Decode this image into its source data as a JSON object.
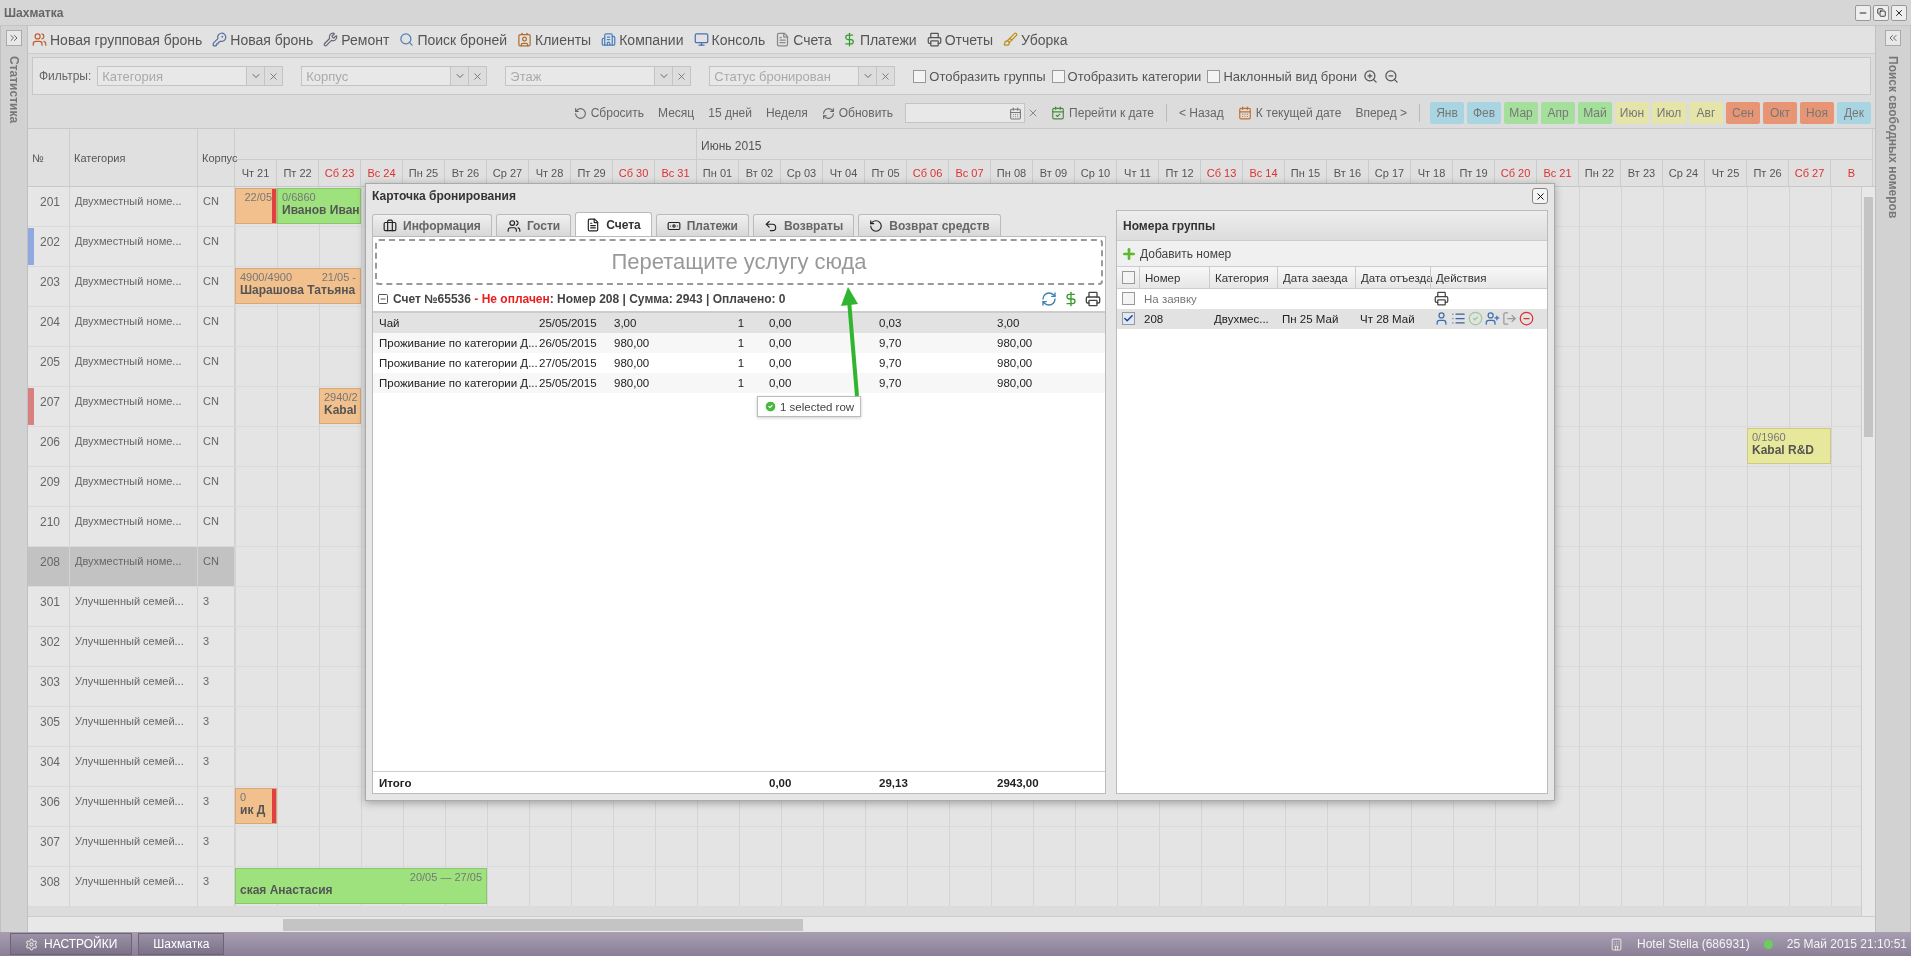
{
  "window": {
    "title": "Шахматка"
  },
  "left_panel": {
    "title": "Статистика"
  },
  "right_panel": {
    "title": "Поиск свободных номеров"
  },
  "menu": [
    "Новая групповая бронь",
    "Новая бронь",
    "Ремонт",
    "Поиск броней",
    "Клиенты",
    "Компании",
    "Консоль",
    "Счета",
    "Платежи",
    "Отчеты",
    "Уборка"
  ],
  "filters": {
    "label": "Фильтры:",
    "combos": [
      {
        "placeholder": "Категория"
      },
      {
        "placeholder": "Корпус"
      },
      {
        "placeholder": "Этаж"
      },
      {
        "placeholder": "Статус бронирован"
      }
    ],
    "checkboxes": [
      {
        "label": "Отобразить группы",
        "checked": false
      },
      {
        "label": "Отобразить категории",
        "checked": false
      },
      {
        "label": "Наклонный вид брони",
        "checked": false
      }
    ]
  },
  "navigation": {
    "reset": "Сбросить",
    "views": [
      "Месяц",
      "15 дней",
      "Неделя"
    ],
    "refresh": "Обновить",
    "goto": "Перейти к дате",
    "back": "< Назад",
    "today": "К текущей дате",
    "forward": "Вперед >",
    "months": [
      {
        "label": "Янв",
        "color": "#a9d5e3"
      },
      {
        "label": "Фев",
        "color": "#a9d5e3"
      },
      {
        "label": "Мар",
        "color": "#a5df9c"
      },
      {
        "label": "Апр",
        "color": "#a5df9c"
      },
      {
        "label": "Май",
        "color": "#a5df9c"
      },
      {
        "label": "Июн",
        "color": "#e5e4a9"
      },
      {
        "label": "Июл",
        "color": "#e5e4a9"
      },
      {
        "label": "Авг",
        "color": "#e5e4a9"
      },
      {
        "label": "Сен",
        "color": "#e79574"
      },
      {
        "label": "Окт",
        "color": "#e79574"
      },
      {
        "label": "Ноя",
        "color": "#e79574"
      },
      {
        "label": "Дек",
        "color": "#a9d5e3"
      }
    ]
  },
  "grid": {
    "columns": [
      "№",
      "Категория",
      "Корпус"
    ],
    "months": [
      {
        "days": [
          {
            "label": "Чт 21",
            "weekend": false
          },
          {
            "label": "Пт 22",
            "weekend": false
          },
          {
            "label": "Сб 23",
            "weekend": true
          },
          {
            "label": "Вс 24",
            "weekend": true
          },
          {
            "label": "Пн 25",
            "weekend": false
          },
          {
            "label": "Вт 26",
            "weekend": false
          },
          {
            "label": "Ср 27",
            "weekend": false
          },
          {
            "label": "Чт 28",
            "weekend": false
          },
          {
            "label": "Пт 29",
            "weekend": false
          },
          {
            "label": "Сб 30",
            "weekend": true
          },
          {
            "label": "Вс 31",
            "weekend": true
          }
        ]
      },
      {
        "label": "Июнь 2015",
        "days": [
          {
            "label": "Пн 01",
            "weekend": false
          },
          {
            "label": "Вт 02",
            "weekend": false
          },
          {
            "label": "Ср 03",
            "weekend": false
          },
          {
            "label": "Чт 04",
            "weekend": false
          },
          {
            "label": "Пт 05",
            "weekend": false
          },
          {
            "label": "Сб 06",
            "weekend": true
          },
          {
            "label": "Вс 07",
            "weekend": true
          },
          {
            "label": "Пн 08",
            "weekend": false
          },
          {
            "label": "Вт 09",
            "weekend": false
          },
          {
            "label": "Ср 10",
            "weekend": false
          },
          {
            "label": "Чт 11",
            "weekend": false
          },
          {
            "label": "Пт 12",
            "weekend": false
          },
          {
            "label": "Сб 13",
            "weekend": true
          },
          {
            "label": "Вс 14",
            "weekend": true
          },
          {
            "label": "Пн 15",
            "weekend": false
          },
          {
            "label": "Вт 16",
            "weekend": false
          },
          {
            "label": "Ср 17",
            "weekend": false
          },
          {
            "label": "Чт 18",
            "weekend": false
          },
          {
            "label": "Пт 19",
            "weekend": false
          },
          {
            "label": "Сб 20",
            "weekend": true
          },
          {
            "label": "Вс 21",
            "weekend": true
          },
          {
            "label": "Пн 22",
            "weekend": false
          },
          {
            "label": "Вт 23",
            "weekend": false
          },
          {
            "label": "Ср 24",
            "weekend": false
          },
          {
            "label": "Чт 25",
            "weekend": false
          },
          {
            "label": "Пт 26",
            "weekend": false
          },
          {
            "label": "Сб 27",
            "weekend": true
          },
          {
            "label": "В",
            "weekend": true
          }
        ]
      }
    ],
    "rows": [
      {
        "number": "201",
        "category": "Двухместный номе...",
        "building": "CN",
        "selected": false,
        "timeline": [
          {
            "kind": "booking",
            "color": "#f2c08c",
            "marked": true,
            "dates": "22/05"
          },
          {
            "kind": "booking",
            "color": "#9ee27e",
            "marked": false,
            "amount": "0/6860",
            "name": "Иванов Иван"
          },
          {
            "kind": "continued"
          }
        ]
      },
      {
        "number": "202",
        "category": "Двухместный номе...",
        "building": "CN",
        "selected": false,
        "color": "#8fa8e0"
      },
      {
        "number": "203",
        "category": "Двухместный номе...",
        "building": "CN",
        "selected": false,
        "timeline": [
          {
            "kind": "booking",
            "color": "#f2c08c",
            "marked": false,
            "amount": "4900/4900",
            "dates": "21/05 -",
            "name": "Шарашова Татьяна"
          },
          {
            "kind": "continued"
          },
          {
            "kind": "continued"
          }
        ]
      },
      {
        "number": "204",
        "category": "Двухместный номе...",
        "building": "CN",
        "selected": false
      },
      {
        "number": "205",
        "category": "Двухместный номе...",
        "building": "CN",
        "selected": false
      },
      {
        "number": "207",
        "category": "Двухместный номе...",
        "building": "CN",
        "selected": false,
        "color": "#d88080",
        "timeline": [
          {
            "kind": "free"
          },
          {
            "kind": "free"
          },
          {
            "kind": "booking",
            "color": "#f2c08c",
            "marked": false,
            "amount": "2940/2",
            "name": "Kabal"
          }
        ]
      },
      {
        "number": "206",
        "category": "Двухместный номе...",
        "building": "CN",
        "selected": false,
        "timeline": [
          {
            "kind": "free"
          },
          {
            "kind": "free"
          },
          {
            "kind": "free"
          },
          {
            "kind": "free"
          },
          {
            "kind": "free"
          },
          {
            "kind": "free"
          },
          {
            "kind": "free"
          },
          {
            "kind": "free"
          },
          {
            "kind": "free"
          },
          {
            "kind": "free"
          },
          {
            "kind": "free"
          },
          {
            "kind": "free"
          },
          {
            "kind": "free"
          },
          {
            "kind": "free"
          },
          {
            "kind": "free"
          },
          {
            "kind": "free"
          },
          {
            "kind": "free"
          },
          {
            "kind": "free"
          },
          {
            "kind": "free"
          },
          {
            "kind": "free"
          },
          {
            "kind": "free"
          },
          {
            "kind": "free"
          },
          {
            "kind": "free"
          },
          {
            "kind": "free"
          },
          {
            "kind": "free"
          },
          {
            "kind": "free"
          },
          {
            "kind": "free"
          },
          {
            "kind": "free"
          },
          {
            "kind": "free"
          },
          {
            "kind": "free"
          },
          {
            "kind": "free"
          },
          {
            "kind": "free"
          },
          {
            "kind": "free"
          },
          {
            "kind": "free"
          },
          {
            "kind": "free"
          },
          {
            "kind": "free"
          },
          {
            "kind": "booking",
            "color": "#e8e89c",
            "marked": false,
            "amount": "0/1960",
            "name": "Kabal R&D"
          },
          {
            "kind": "continued"
          }
        ]
      },
      {
        "number": "209",
        "category": "Двухместный номе...",
        "building": "CN",
        "selected": false
      },
      {
        "number": "210",
        "category": "Двухместный номе...",
        "building": "CN",
        "selected": false
      },
      {
        "number": "208",
        "category": "Двухместный номе...",
        "building": "CN",
        "selected": true
      },
      {
        "number": "301",
        "category": "Улучшенный семей...",
        "building": "3",
        "selected": false
      },
      {
        "number": "302",
        "category": "Улучшенный семей...",
        "building": "3",
        "selected": false
      },
      {
        "number": "303",
        "category": "Улучшенный семей...",
        "building": "3",
        "selected": false
      },
      {
        "number": "305",
        "category": "Улучшенный семей...",
        "building": "3",
        "selected": false
      },
      {
        "number": "304",
        "category": "Улучшенный семей...",
        "building": "3",
        "selected": false
      },
      {
        "number": "306",
        "category": "Улучшенный семей...",
        "building": "3",
        "selected": false,
        "timeline": [
          {
            "kind": "booking",
            "color": "#f2c08c",
            "marked": true,
            "amount": "0",
            "name": "ик Д"
          }
        ]
      },
      {
        "number": "307",
        "category": "Улучшенный семей...",
        "building": "3",
        "selected": false
      },
      {
        "number": "308",
        "category": "Улучшенный семей...",
        "building": "3",
        "selected": false,
        "timeline": [
          {
            "kind": "booking",
            "color": "#9ee27e",
            "marked": false,
            "dates": "20/05 — 27/05",
            "name": "ская Анастасия"
          },
          {
            "kind": "continued"
          },
          {
            "kind": "continued"
          },
          {
            "kind": "continued"
          },
          {
            "kind": "continued"
          },
          {
            "kind": "continued"
          }
        ]
      }
    ]
  },
  "modal": {
    "title": "Карточка бронирования",
    "tabs": [
      {
        "label": "Информация",
        "selected": false
      },
      {
        "label": "Гости",
        "selected": false
      },
      {
        "label": "Счета",
        "selected": true
      },
      {
        "label": "Платежи",
        "selected": false
      },
      {
        "label": "Возвраты",
        "selected": false
      },
      {
        "label": "Возврат средств",
        "selected": false
      }
    ],
    "drop_zone": "Перетащите услугу сюда",
    "invoice": {
      "title": "Счет №65536",
      "status": "- Не оплачен",
      "details": ": Номер 208 | Сумма: 2943 | Оплачено: 0",
      "rows": [
        {
          "selected": true,
          "cells": [
            "Чай",
            "25/05/2015",
            "3,00",
            "1",
            "0,00",
            "0,03",
            "3,00"
          ]
        },
        {
          "selected": false,
          "cells": [
            "Проживание по категории Д...",
            "26/05/2015",
            "980,00",
            "1",
            "0,00",
            "9,70",
            "980,00"
          ]
        },
        {
          "selected": false,
          "cells": [
            "Проживание по категории Д...",
            "27/05/2015",
            "980,00",
            "1",
            "0,00",
            "9,70",
            "980,00"
          ]
        },
        {
          "selected": false,
          "cells": [
            "Проживание по категории Д...",
            "25/05/2015",
            "980,00",
            "1",
            "0,00",
            "9,70",
            "980,00"
          ]
        }
      ],
      "tooltip": "1 selected row",
      "total": {
        "label": "Итого",
        "values": [
          "0,00",
          "29,13",
          "2943,00"
        ]
      }
    },
    "group": {
      "title": "Номера группы",
      "add": "Добавить номер",
      "columns": [
        "Номер",
        "Категория",
        "Дата заезда",
        "Дата отъезда",
        "Действия"
      ],
      "all_checked": false,
      "rows": [
        {
          "kind": "request",
          "checked": false,
          "selected": false,
          "label": "На заявку"
        },
        {
          "kind": "room",
          "checked": true,
          "selected": true,
          "cells": [
            "208",
            "Двухмес...",
            "Пн 25 Май",
            "Чт 28 Май"
          ]
        }
      ]
    }
  },
  "taskbar": {
    "items": [
      "НАСТРОЙКИ",
      "Шахматка"
    ],
    "hotel": "Hotel Stella (686931)",
    "online": true,
    "clock": "25 Май 2015 21:10:51"
  }
}
